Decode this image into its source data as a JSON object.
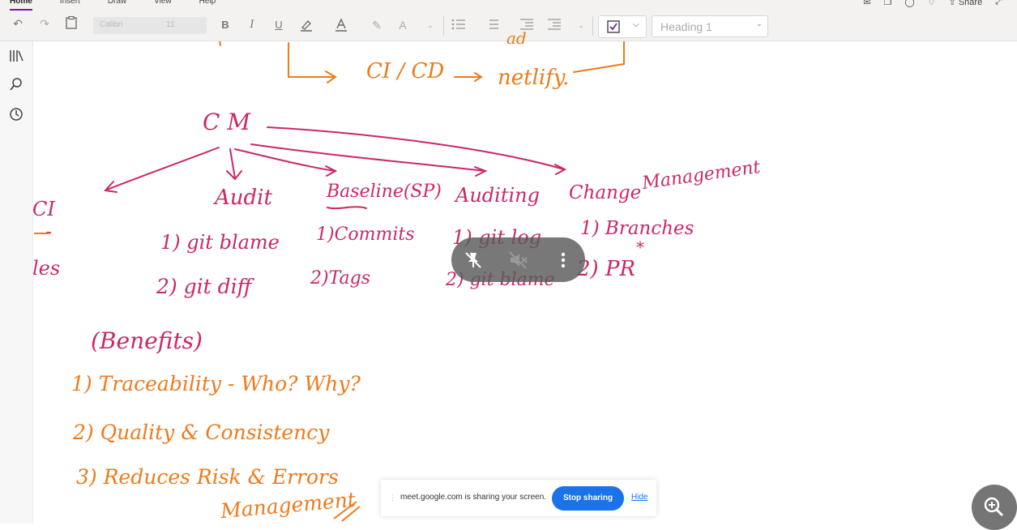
{
  "ribbon": {
    "tabs": [
      "Home",
      "Insert",
      "Draw",
      "View",
      "Help"
    ],
    "share_label": "Share",
    "font_name": "Calibri",
    "font_size": "11",
    "style_value": "Heading 1",
    "accent": "#7719aa"
  },
  "notes": {
    "top_right_fragment": "ad",
    "ci_cd": "CI / CD",
    "netlify": "netlify.",
    "cm": "C M",
    "audit": "Audit",
    "baseline": "Baseline(SP)",
    "auditing": "Auditing",
    "change": "Change",
    "management": "Management",
    "git_blame": "1) git blame",
    "commits": "1)Commits",
    "git_log": "1) git log",
    "branches": "1) Branches",
    "git_diff": "2) git diff",
    "tags": "2)Tags",
    "git_blame2": "2) git blame",
    "pr": "2) PR",
    "asterisk": "*",
    "ci": "CI",
    "les": "les",
    "benefits": "(Benefits)",
    "traceability": "1) Traceability - Who? Why?",
    "quality": "2) Quality & Consistency",
    "reduces": "3) Reduces Risk & Errors",
    "management2": "Management",
    "colors": {
      "pink": "#c8286a",
      "orange": "#ee7a1a"
    }
  },
  "sharing": {
    "message": "meet.google.com is sharing your screen.",
    "stop_label": "Stop sharing",
    "hide_label": "Hide"
  },
  "icons": [
    "undo-icon",
    "redo-icon",
    "clipboard-icon",
    "bold-icon",
    "italic-icon",
    "underline-icon",
    "highlight-icon",
    "font-color-icon",
    "eraser-icon",
    "format-icon",
    "bullets-icon",
    "numbering-icon",
    "outdent-icon",
    "indent-icon",
    "checkbox-icon",
    "library-icon",
    "search-icon",
    "history-icon",
    "unpin-icon",
    "mute-icon",
    "more-icon",
    "zoom-in-icon"
  ]
}
